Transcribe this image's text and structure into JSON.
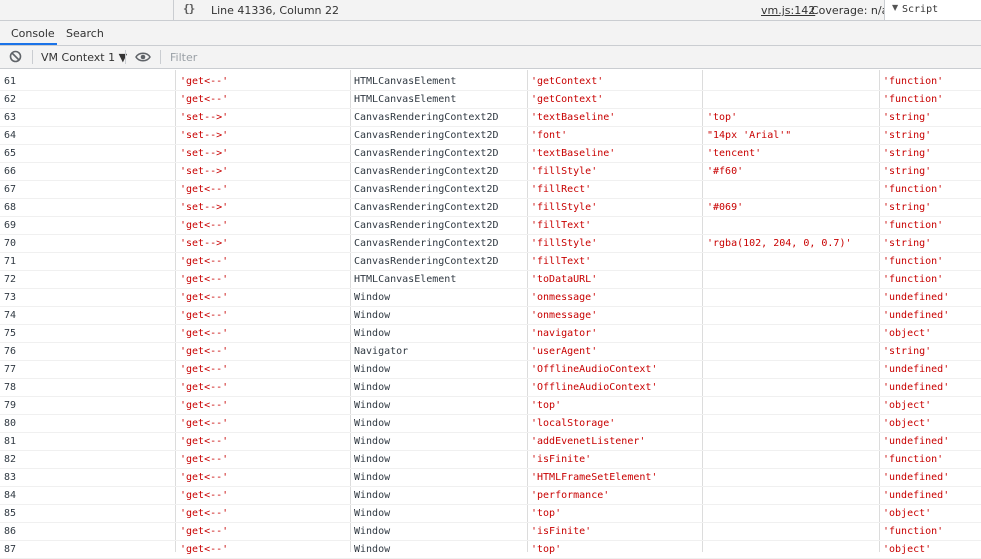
{
  "statusbar": {
    "pretty_print": "{}",
    "cursor": "Line 41336, Column 22",
    "source_link": "vm.js:142",
    "coverage": "Coverage: n/a",
    "script_select": "Script"
  },
  "tabs": [
    {
      "label": "Console",
      "active": true
    },
    {
      "label": "Search",
      "active": false
    }
  ],
  "toolbar": {
    "context": "VM Context 1 ▼",
    "filter_placeholder": "Filter"
  },
  "table": {
    "rows": [
      [
        "61",
        "'get<--'",
        "HTMLCanvasElement",
        "'getContext'",
        "",
        "'function'"
      ],
      [
        "62",
        "'get<--'",
        "HTMLCanvasElement",
        "'getContext'",
        "",
        "'function'"
      ],
      [
        "63",
        "'set-->'",
        "CanvasRenderingContext2D",
        "'textBaseline'",
        "'top'",
        "'string'"
      ],
      [
        "64",
        "'set-->'",
        "CanvasRenderingContext2D",
        "'font'",
        "\"14px 'Arial'\"",
        "'string'"
      ],
      [
        "65",
        "'set-->'",
        "CanvasRenderingContext2D",
        "'textBaseline'",
        "'tencent'",
        "'string'"
      ],
      [
        "66",
        "'set-->'",
        "CanvasRenderingContext2D",
        "'fillStyle'",
        "'#f60'",
        "'string'"
      ],
      [
        "67",
        "'get<--'",
        "CanvasRenderingContext2D",
        "'fillRect'",
        "",
        "'function'"
      ],
      [
        "68",
        "'set-->'",
        "CanvasRenderingContext2D",
        "'fillStyle'",
        "'#069'",
        "'string'"
      ],
      [
        "69",
        "'get<--'",
        "CanvasRenderingContext2D",
        "'fillText'",
        "",
        "'function'"
      ],
      [
        "70",
        "'set-->'",
        "CanvasRenderingContext2D",
        "'fillStyle'",
        "'rgba(102, 204, 0, 0.7)'",
        "'string'"
      ],
      [
        "71",
        "'get<--'",
        "CanvasRenderingContext2D",
        "'fillText'",
        "",
        "'function'"
      ],
      [
        "72",
        "'get<--'",
        "HTMLCanvasElement",
        "'toDataURL'",
        "",
        "'function'"
      ],
      [
        "73",
        "'get<--'",
        "Window",
        "'onmessage'",
        "",
        "'undefined'"
      ],
      [
        "74",
        "'get<--'",
        "Window",
        "'onmessage'",
        "",
        "'undefined'"
      ],
      [
        "75",
        "'get<--'",
        "Window",
        "'navigator'",
        "",
        "'object'"
      ],
      [
        "76",
        "'get<--'",
        "Navigator",
        "'userAgent'",
        "",
        "'string'"
      ],
      [
        "77",
        "'get<--'",
        "Window",
        "'OfflineAudioContext'",
        "",
        "'undefined'"
      ],
      [
        "78",
        "'get<--'",
        "Window",
        "'OfflineAudioContext'",
        "",
        "'undefined'"
      ],
      [
        "79",
        "'get<--'",
        "Window",
        "'top'",
        "",
        "'object'"
      ],
      [
        "80",
        "'get<--'",
        "Window",
        "'localStorage'",
        "",
        "'object'"
      ],
      [
        "81",
        "'get<--'",
        "Window",
        "'addEvenetListener'",
        "",
        "'undefined'"
      ],
      [
        "82",
        "'get<--'",
        "Window",
        "'isFinite'",
        "",
        "'function'"
      ],
      [
        "83",
        "'get<--'",
        "Window",
        "'HTMLFrameSetElement'",
        "",
        "'undefined'"
      ],
      [
        "84",
        "'get<--'",
        "Window",
        "'performance'",
        "",
        "'undefined'"
      ],
      [
        "85",
        "'get<--'",
        "Window",
        "'top'",
        "",
        "'object'"
      ],
      [
        "86",
        "'get<--'",
        "Window",
        "'isFinite'",
        "",
        "'function'"
      ],
      [
        "87",
        "'get<--'",
        "Window",
        "'top'",
        "",
        "'object'"
      ]
    ]
  }
}
